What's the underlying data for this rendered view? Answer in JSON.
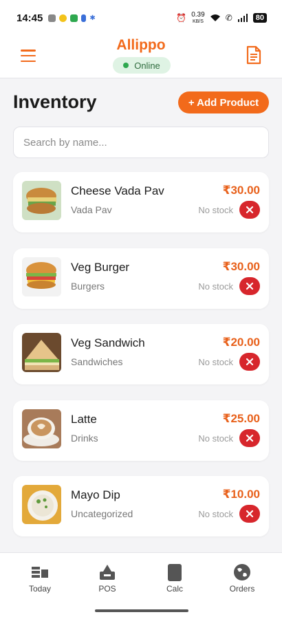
{
  "status_bar": {
    "time": "14:45",
    "data_speed": "0.39",
    "data_unit": "KB/S",
    "battery": "80"
  },
  "header": {
    "app_name": "Allippo",
    "status": "Online"
  },
  "page": {
    "title": "Inventory",
    "add_button": "+ Add Product",
    "search_placeholder": "Search by name..."
  },
  "products": [
    {
      "name": "Cheese Vada Pav",
      "category": "Vada Pav",
      "price": "₹30.00",
      "stock": "No stock",
      "image": "vada-pav"
    },
    {
      "name": "Veg Burger",
      "category": "Burgers",
      "price": "₹30.00",
      "stock": "No stock",
      "image": "burger"
    },
    {
      "name": "Veg Sandwich",
      "category": "Sandwiches",
      "price": "₹20.00",
      "stock": "No stock",
      "image": "sandwich"
    },
    {
      "name": "Latte",
      "category": "Drinks",
      "price": "₹25.00",
      "stock": "No stock",
      "image": "latte"
    },
    {
      "name": "Mayo Dip",
      "category": "Uncategorized",
      "price": "₹10.00",
      "stock": "No stock",
      "image": "mayo-dip"
    }
  ],
  "nav": {
    "items": [
      {
        "label": "Today",
        "icon": "today-icon"
      },
      {
        "label": "POS",
        "icon": "pos-icon"
      },
      {
        "label": "Calc",
        "icon": "calculator-icon"
      },
      {
        "label": "Orders",
        "icon": "globe-icon"
      }
    ]
  },
  "colors": {
    "accent": "#f26a1b",
    "price": "#e8601a",
    "delete": "#d7262c",
    "online_bg": "#dff3e4",
    "online_dot": "#2ea84f"
  }
}
